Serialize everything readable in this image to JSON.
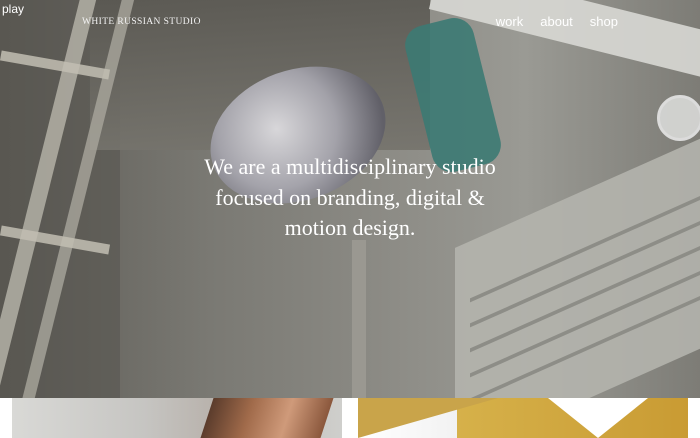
{
  "corner_label": "play",
  "brand": {
    "logo_text": "WHITE RUSSIAN STUDIO"
  },
  "nav": [
    {
      "label": "work"
    },
    {
      "label": "about"
    },
    {
      "label": "shop"
    }
  ],
  "hero": {
    "headline_lines": [
      "We are a multidisciplinary studio",
      "focused on branding, digital &",
      "motion design."
    ]
  }
}
